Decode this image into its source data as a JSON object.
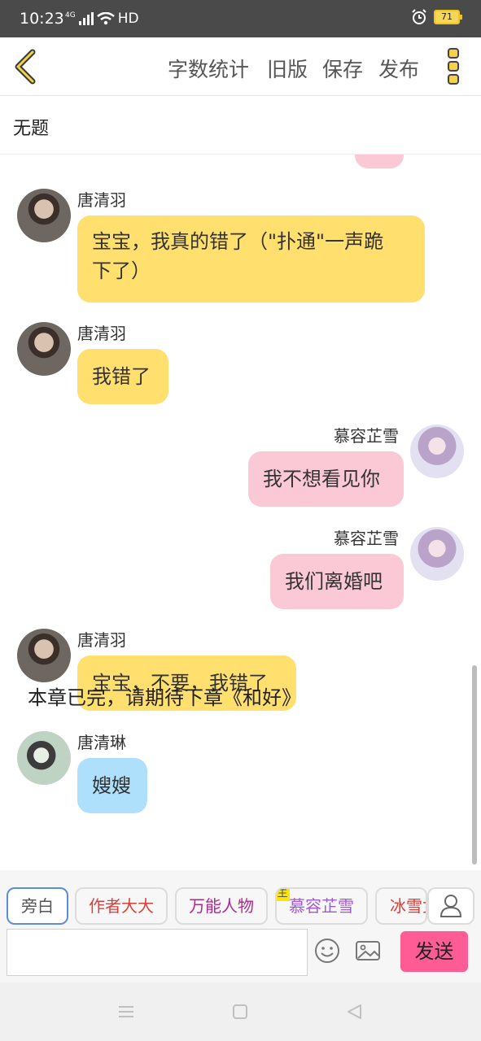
{
  "status_bar": {
    "time": "10:23",
    "network": "4G",
    "hd": "HD",
    "battery": "71"
  },
  "toolbar": {
    "word_count": "字数统计",
    "old_version": "旧版",
    "save": "保存",
    "publish": "发布"
  },
  "chapter_title": "无题",
  "messages": [
    {
      "sender": "唐清羽",
      "text": "宝宝，我真的错了（\"扑通\"一声跪下了）",
      "line1": "宝宝，我真的错了（\"扑通\"一声跪",
      "line2": "下了）"
    },
    {
      "sender": "唐清羽",
      "text": "我错了"
    },
    {
      "sender": "慕容芷雪",
      "text": "我不想看见你"
    },
    {
      "sender": "慕容芷雪",
      "text": "我们离婚吧"
    },
    {
      "sender": "唐清羽",
      "text": "宝宝，不要，我错了"
    },
    {
      "sender": "唐清琳",
      "text": "嫂嫂"
    }
  ],
  "narration": "本章已完，请期待下章《和好》",
  "roles": [
    {
      "label": "旁白",
      "color": "#555555"
    },
    {
      "label": "作者大大",
      "color": "#d9403a"
    },
    {
      "label": "万能人物",
      "color": "#b02a8a"
    },
    {
      "label": "慕容芷雪",
      "color": "#a05bd0",
      "badge": "主"
    },
    {
      "label": "冰雪女",
      "color": "#d9403a"
    }
  ],
  "input": {
    "placeholder": ""
  },
  "send_label": "发送"
}
